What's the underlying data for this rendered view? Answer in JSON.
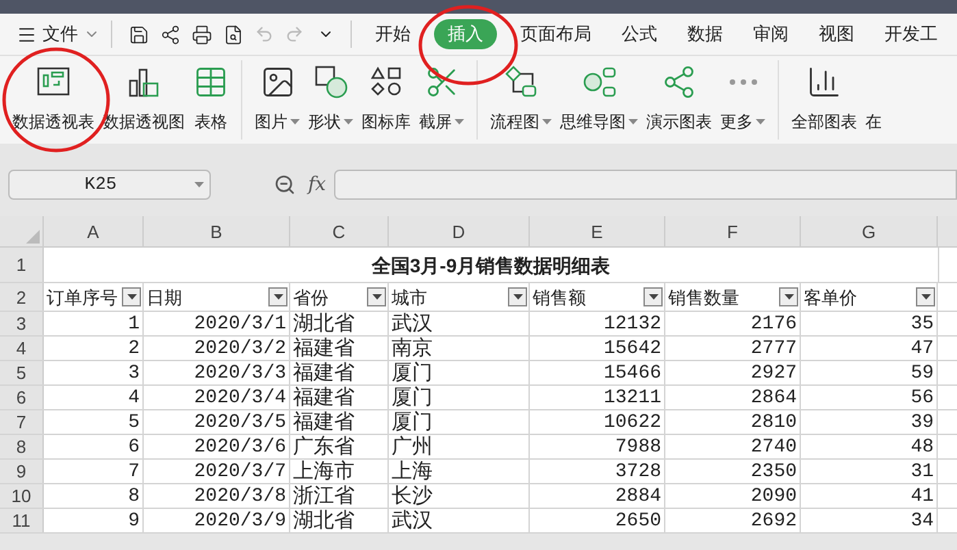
{
  "menu": {
    "file": "文件",
    "tabs": [
      {
        "label": "开始",
        "selected": false
      },
      {
        "label": "插入",
        "selected": true
      },
      {
        "label": "页面布局",
        "selected": false
      },
      {
        "label": "公式",
        "selected": false
      },
      {
        "label": "数据",
        "selected": false
      },
      {
        "label": "审阅",
        "selected": false
      },
      {
        "label": "视图",
        "selected": false
      },
      {
        "label": "开发工",
        "selected": false
      }
    ]
  },
  "ribbon": [
    [
      {
        "label": "数据透视表",
        "dropdown": false
      },
      {
        "label": "数据透视图",
        "dropdown": false
      },
      {
        "label": "表格",
        "dropdown": false
      }
    ],
    [
      {
        "label": "图片",
        "dropdown": true
      },
      {
        "label": "形状",
        "dropdown": true
      },
      {
        "label": "图标库",
        "dropdown": false
      },
      {
        "label": "截屏",
        "dropdown": true
      }
    ],
    [
      {
        "label": "流程图",
        "dropdown": true
      },
      {
        "label": "思维导图",
        "dropdown": true
      },
      {
        "label": "演示图表",
        "dropdown": false
      },
      {
        "label": "更多",
        "dropdown": true
      }
    ],
    [
      {
        "label": "全部图表",
        "dropdown": false
      },
      {
        "label": "在",
        "dropdown": false
      }
    ]
  ],
  "name_box": "K25",
  "fx": "fx",
  "sheet": {
    "columns": [
      "A",
      "B",
      "C",
      "D",
      "E",
      "F",
      "G"
    ],
    "title_row": "1",
    "title": "全国3月-9月销售数据明细表",
    "header_row": "2",
    "headers": [
      "订单序号",
      "日期",
      "省份",
      "城市",
      "销售额",
      "销售数量",
      "客单价"
    ],
    "rows": [
      {
        "number": "3",
        "cells": [
          "1",
          "2020/3/1",
          "湖北省",
          "武汉",
          "12132",
          "2176",
          "35"
        ]
      },
      {
        "number": "4",
        "cells": [
          "2",
          "2020/3/2",
          "福建省",
          "南京",
          "15642",
          "2777",
          "47"
        ]
      },
      {
        "number": "5",
        "cells": [
          "3",
          "2020/3/3",
          "福建省",
          "厦门",
          "15466",
          "2927",
          "59"
        ]
      },
      {
        "number": "6",
        "cells": [
          "4",
          "2020/3/4",
          "福建省",
          "厦门",
          "13211",
          "2864",
          "56"
        ]
      },
      {
        "number": "7",
        "cells": [
          "5",
          "2020/3/5",
          "福建省",
          "厦门",
          "10622",
          "2810",
          "39"
        ]
      },
      {
        "number": "8",
        "cells": [
          "6",
          "2020/3/6",
          "广东省",
          "广州",
          "7988",
          "2740",
          "48"
        ]
      },
      {
        "number": "9",
        "cells": [
          "7",
          "2020/3/7",
          "上海市",
          "上海",
          "3728",
          "2350",
          "31"
        ]
      },
      {
        "number": "10",
        "cells": [
          "8",
          "2020/3/8",
          "浙江省",
          "长沙",
          "2884",
          "2090",
          "41"
        ]
      },
      {
        "number": "11",
        "cells": [
          "9",
          "2020/3/9",
          "湖北省",
          "武汉",
          "2650",
          "2692",
          "34"
        ]
      }
    ]
  }
}
